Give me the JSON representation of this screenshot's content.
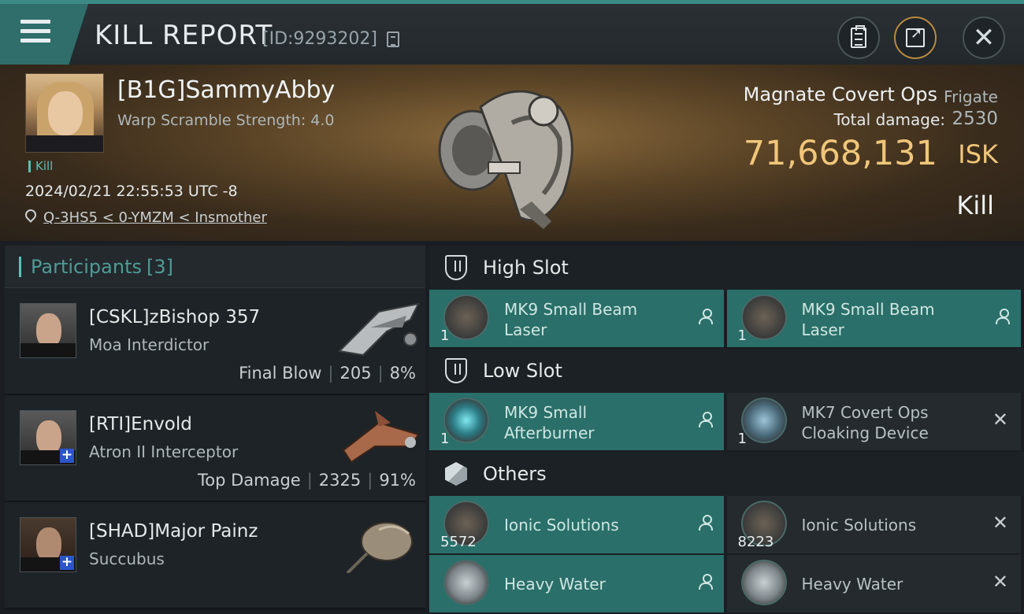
{
  "header": {
    "title": "KILL REPORT",
    "report_id": "[ID:9293202]"
  },
  "victim": {
    "name": "[B1G]SammyAbby",
    "warp_scramble": "Warp Scramble Strength: 4.0",
    "tag": "Kill",
    "time": "2024/02/21 22:55:53 UTC -8",
    "location": "Q-3HS5 < 0-YMZM < Insmother",
    "ship_name": "Magnate Covert Ops",
    "ship_class": "Frigate",
    "damage_label": "Total damage:",
    "damage_value": "2530",
    "isk_value": "71,668,131",
    "isk_label": "ISK",
    "result": "Kill"
  },
  "participants": {
    "label": "Participants",
    "count": "[3]",
    "items": [
      {
        "name": "[CSKL]zBishop 357",
        "ship": "Moa Interdictor",
        "role": "Final Blow",
        "damage": "205",
        "percent": "8%"
      },
      {
        "name": "[RTI]Envold",
        "ship": "Atron II Interceptor",
        "role": "Top Damage",
        "damage": "2325",
        "percent": "91%"
      },
      {
        "name": "[SHAD]Major Painz",
        "ship": "Succubus",
        "role": "",
        "damage": "",
        "percent": ""
      }
    ]
  },
  "fittings": {
    "high_slot": {
      "label": "High Slot",
      "modules": [
        {
          "name": "MK9 Small Beam Laser",
          "qty": "1"
        },
        {
          "name": "MK9 Small Beam Laser",
          "qty": "1"
        }
      ]
    },
    "low_slot": {
      "label": "Low Slot",
      "modules": [
        {
          "name": "MK9 Small Afterburner",
          "qty": "1"
        },
        {
          "name": "MK7 Covert Ops Cloaking Device",
          "qty": "1"
        }
      ]
    },
    "others": {
      "label": "Others",
      "modules": [
        {
          "name": "Ionic Solutions",
          "qty": "5572"
        },
        {
          "name": "Ionic Solutions",
          "qty": "8223"
        },
        {
          "name": "Heavy Water",
          "qty": ""
        },
        {
          "name": "Heavy Water",
          "qty": ""
        }
      ]
    }
  },
  "colors": {
    "accent": "#5ec2b8",
    "isk": "#f0c67a",
    "module_dropped": "#2a6f69"
  }
}
